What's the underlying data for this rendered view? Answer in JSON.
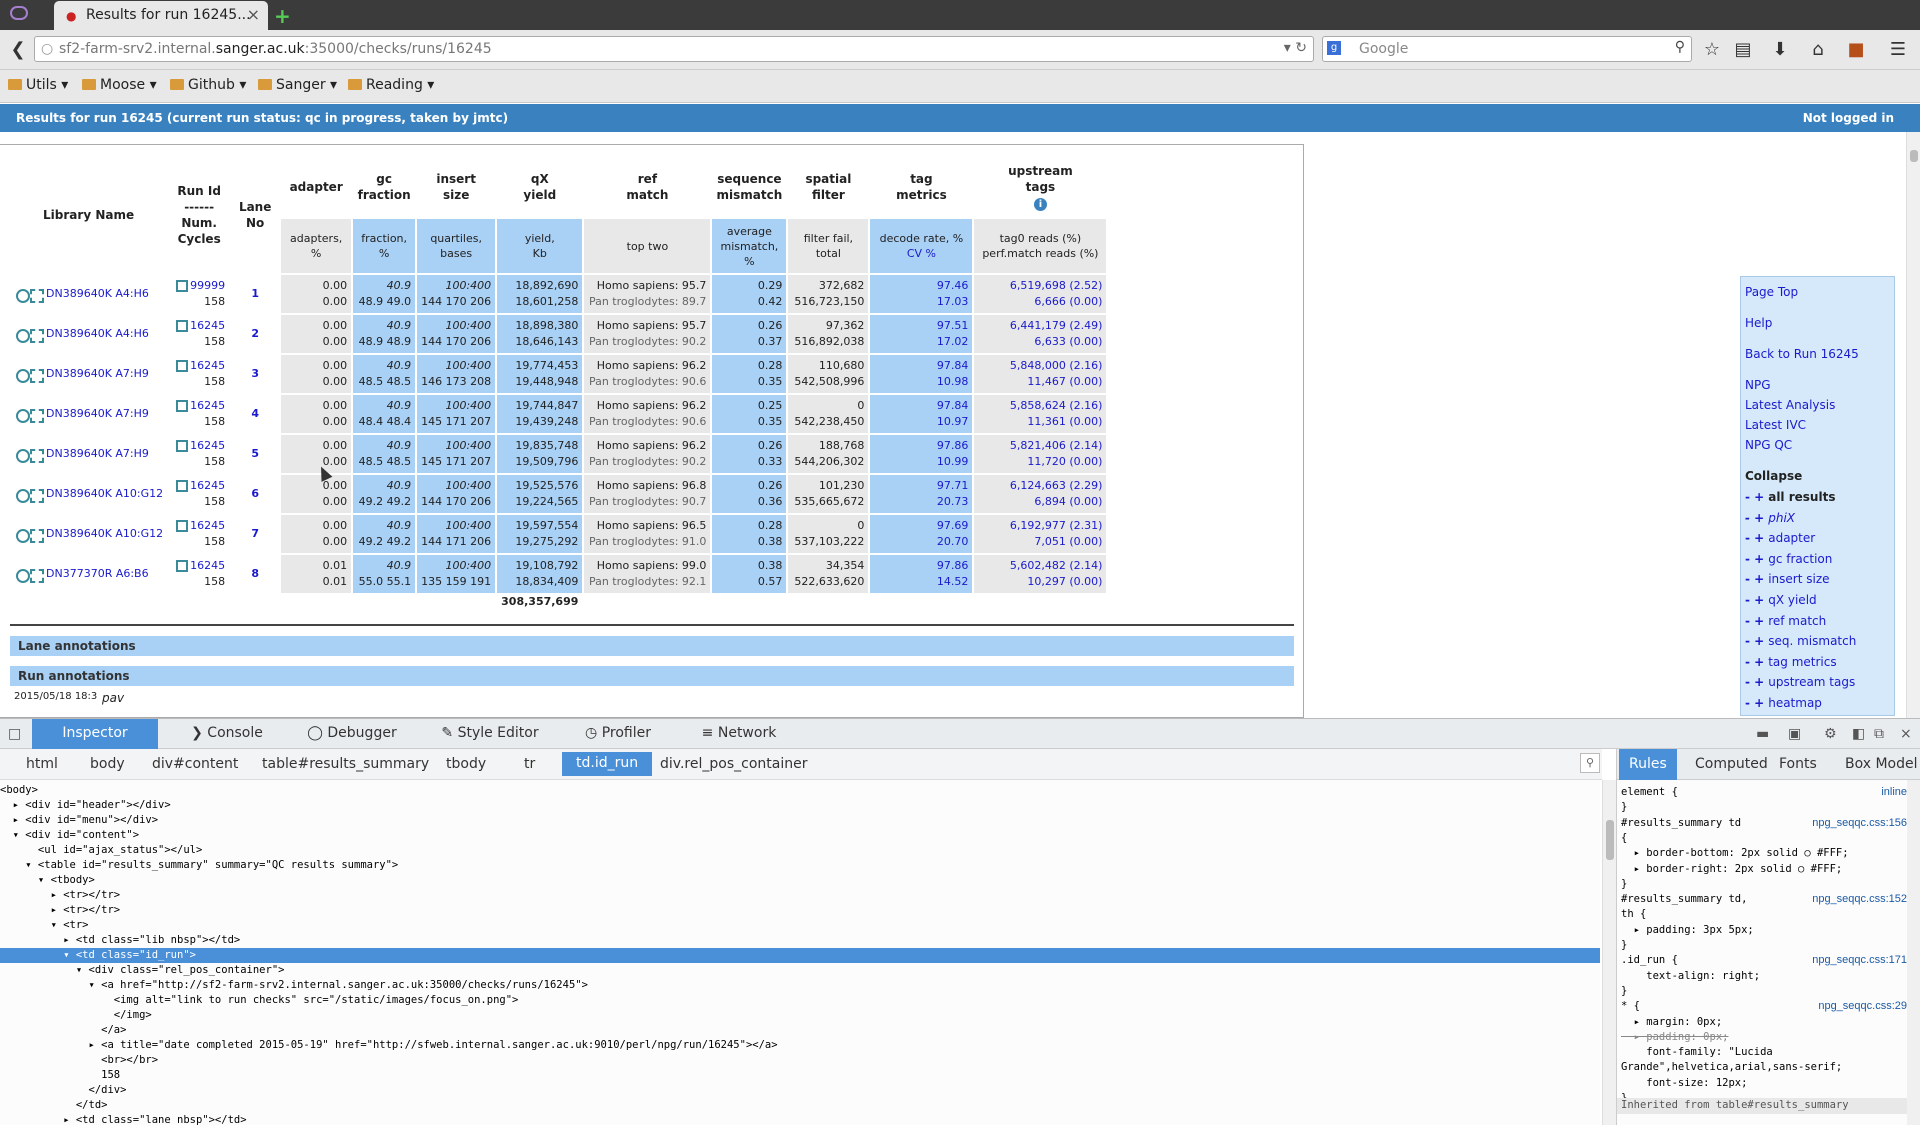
{
  "browser": {
    "tab_title": "Results for run 16245...",
    "url_prefix": "sf2-farm-srv2.internal.",
    "url_domain": "sanger.ac.uk",
    "url_suffix": ":35000/checks/runs/16245",
    "search_placeholder": "Google",
    "bookmarks": [
      "Utils",
      "Moose",
      "Github",
      "Sanger",
      "Reading"
    ]
  },
  "header": {
    "title": "Results for run 16245 (current run status: qc in progress, taken by jmtc)",
    "login_status": "Not logged in"
  },
  "table": {
    "headers": {
      "library": "Library Name",
      "run_id": "Run Id",
      "run_sep": "------",
      "num": "Num.",
      "cycles": "Cycles",
      "lane": "Lane",
      "lane_no": "No",
      "adapter": "adapter",
      "gc1": "gc",
      "gc2": "fraction",
      "insert1": "insert",
      "insert2": "size",
      "qx1": "qX",
      "qx2": "yield",
      "ref1": "ref",
      "ref2": "match",
      "seq1": "sequence",
      "seq2": "mismatch",
      "spatial1": "spatial",
      "spatial2": "filter",
      "tag1": "tag",
      "tag2": "metrics",
      "up1": "upstream",
      "up2": "tags"
    },
    "subheaders": {
      "adapter1": "adapters,",
      "adapter2": "%",
      "gc1": "fraction,",
      "gc2": "%",
      "insert1": "quartiles,",
      "insert2": "bases",
      "qx1": "yield,",
      "qx2": "Kb",
      "ref": "top two",
      "seq1": "average",
      "seq2": "mismatch,",
      "seq3": "%",
      "spatial1": "filter fail,",
      "spatial2": "total",
      "tag1": "decode rate, %",
      "tag2": "CV %",
      "up1": "tag0 reads (%)",
      "up2": "perf.match reads (%)"
    },
    "rows": [
      {
        "lib": "DN389640K A4:H6",
        "run": "99999",
        "cycles": "158",
        "lane": "1",
        "ad1": "0.00",
        "ad2": "0.00",
        "gc1": "40.9",
        "gc2": "48.9 49.0",
        "is1": "100:400",
        "is2": "144 170 206",
        "qx1": "18,892,690",
        "qx2": "18,601,258",
        "ref1": "Homo sapiens: 95.7",
        "ref2": "Pan troglodytes: 89.7",
        "sm1": "0.29",
        "sm2": "0.42",
        "sf1": "372,682",
        "sf2": "516,723,150",
        "tm1": "97.46",
        "tm2": "17.03",
        "up1": "6,519,698 (2.52)",
        "up2": "6,666 (0.00)"
      },
      {
        "lib": "DN389640K A4:H6",
        "run": "16245",
        "cycles": "158",
        "lane": "2",
        "ad1": "0.00",
        "ad2": "0.00",
        "gc1": "40.9",
        "gc2": "48.9 48.9",
        "is1": "100:400",
        "is2": "144 170 206",
        "qx1": "18,898,380",
        "qx2": "18,646,143",
        "ref1": "Homo sapiens: 95.7",
        "ref2": "Pan troglodytes: 90.2",
        "sm1": "0.26",
        "sm2": "0.37",
        "sf1": "97,362",
        "sf2": "516,892,038",
        "tm1": "97.51",
        "tm2": "17.02",
        "up1": "6,441,179 (2.49)",
        "up2": "6,633 (0.00)"
      },
      {
        "lib": "DN389640K A7:H9",
        "run": "16245",
        "cycles": "158",
        "lane": "3",
        "ad1": "0.00",
        "ad2": "0.00",
        "gc1": "40.9",
        "gc2": "48.5 48.5",
        "is1": "100:400",
        "is2": "146 173 208",
        "qx1": "19,774,453",
        "qx2": "19,448,948",
        "ref1": "Homo sapiens: 96.2",
        "ref2": "Pan troglodytes: 90.6",
        "sm1": "0.28",
        "sm2": "0.35",
        "sf1": "110,680",
        "sf2": "542,508,996",
        "tm1": "97.84",
        "tm2": "10.98",
        "up1": "5,848,000 (2.16)",
        "up2": "11,467 (0.00)"
      },
      {
        "lib": "DN389640K A7:H9",
        "run": "16245",
        "cycles": "158",
        "lane": "4",
        "ad1": "0.00",
        "ad2": "0.00",
        "gc1": "40.9",
        "gc2": "48.4 48.4",
        "is1": "100:400",
        "is2": "145 171 207",
        "qx1": "19,744,847",
        "qx2": "19,439,248",
        "ref1": "Homo sapiens: 96.2",
        "ref2": "Pan troglodytes: 90.6",
        "sm1": "0.25",
        "sm2": "0.35",
        "sf1": "0",
        "sf2": "542,238,450",
        "tm1": "97.84",
        "tm2": "10.97",
        "up1": "5,858,624 (2.16)",
        "up2": "11,361 (0.00)"
      },
      {
        "lib": "DN389640K A7:H9",
        "run": "16245",
        "cycles": "158",
        "lane": "5",
        "ad1": "0.00",
        "ad2": "0.00",
        "gc1": "40.9",
        "gc2": "48.5 48.5",
        "is1": "100:400",
        "is2": "145 171 207",
        "qx1": "19,835,748",
        "qx2": "19,509,796",
        "ref1": "Homo sapiens: 96.2",
        "ref2": "Pan troglodytes: 90.2",
        "sm1": "0.26",
        "sm2": "0.33",
        "sf1": "188,768",
        "sf2": "544,206,302",
        "tm1": "97.86",
        "tm2": "10.99",
        "up1": "5,821,406 (2.14)",
        "up2": "11,720 (0.00)"
      },
      {
        "lib": "DN389640K A10:G12",
        "run": "16245",
        "cycles": "158",
        "lane": "6",
        "ad1": "0.00",
        "ad2": "0.00",
        "gc1": "40.9",
        "gc2": "49.2 49.2",
        "is1": "100:400",
        "is2": "144 170 206",
        "qx1": "19,525,576",
        "qx2": "19,224,565",
        "ref1": "Homo sapiens: 96.8",
        "ref2": "Pan troglodytes: 90.7",
        "sm1": "0.26",
        "sm2": "0.36",
        "sf1": "101,230",
        "sf2": "535,665,672",
        "tm1": "97.71",
        "tm2": "20.73",
        "up1": "6,124,663 (2.29)",
        "up2": "6,894 (0.00)"
      },
      {
        "lib": "DN389640K A10:G12",
        "run": "16245",
        "cycles": "158",
        "lane": "7",
        "ad1": "0.00",
        "ad2": "0.00",
        "gc1": "40.9",
        "gc2": "49.2 49.2",
        "is1": "100:400",
        "is2": "144 171 206",
        "qx1": "19,597,554",
        "qx2": "19,275,292",
        "ref1": "Homo sapiens: 96.5",
        "ref2": "Pan troglodytes: 91.0",
        "sm1": "0.28",
        "sm2": "0.38",
        "sf1": "0",
        "sf2": "537,103,222",
        "tm1": "97.69",
        "tm2": "20.70",
        "up1": "6,192,977 (2.31)",
        "up2": "7,051 (0.00)"
      },
      {
        "lib": "DN377370R A6:B6",
        "run": "16245",
        "cycles": "158",
        "lane": "8",
        "ad1": "0.01",
        "ad2": "0.01",
        "gc1": "40.9",
        "gc2": "55.0 55.1",
        "is1": "100:400",
        "is2": "135 159 191",
        "qx1": "19,108,792",
        "qx2": "18,834,409",
        "ref1": "Homo sapiens: 99.0",
        "ref2": "Pan troglodytes: 92.1",
        "sm1": "0.38",
        "sm2": "0.57",
        "sf1": "34,354",
        "sf2": "522,633,620",
        "tm1": "97.86",
        "tm2": "14.52",
        "up1": "5,602,482 (2.14)",
        "up2": "10,297 (0.00)"
      }
    ],
    "total_yield": "308,357,699"
  },
  "annotations": {
    "lane_title": "Lane annotations",
    "run_title": "Run annotations",
    "run_date": "2015/05/18 18:3",
    "run_user": "pav"
  },
  "sidemenu": {
    "page_top": "Page Top",
    "help": "Help",
    "back": "Back to Run 16245",
    "npg": "NPG",
    "latest_analysis": "Latest Analysis",
    "latest_ivc": "Latest IVC",
    "npg_qc": "NPG QC",
    "collapse": "Collapse",
    "pm": "- +",
    "items": [
      "all results",
      "phiX",
      "adapter",
      "gc fraction",
      "insert size",
      "qX yield",
      "ref match",
      "seq. mismatch",
      "tag metrics",
      "upstream tags",
      "heatmap"
    ]
  },
  "devtools": {
    "tabs": [
      "Inspector",
      "Console",
      "Debugger",
      "Style Editor",
      "Profiler",
      "Network"
    ],
    "breadcrumb": [
      "html",
      "body",
      "div#content",
      "table#results_summary",
      "tbody",
      "tr",
      "td.id_run",
      "div.rel_pos_container"
    ],
    "side_tabs": [
      "Rules",
      "Computed",
      "Fonts",
      "Box Model"
    ],
    "markup_lines": [
      "<body>",
      "  ▸ <div id=\"header\"></div>",
      "  ▸ <div id=\"menu\"></div>",
      "  ▾ <div id=\"content\">",
      "      <ul id=\"ajax_status\"></ul>",
      "    ▾ <table id=\"results_summary\" summary=\"QC results summary\">",
      "      ▾ <tbody>",
      "        ▸ <tr></tr>",
      "        ▸ <tr></tr>",
      "        ▾ <tr>",
      "          ▸ <td class=\"lib nbsp\"></td>",
      "          ▾ <td class=\"id_run\">",
      "            ▾ <div class=\"rel_pos_container\">",
      "              ▾ <a href=\"http://sf2-farm-srv2.internal.sanger.ac.uk:35000/checks/runs/16245\">",
      "                  <img alt=\"link to run checks\" src=\"/static/images/focus_on.png\">",
      "                  </img>",
      "                </a>",
      "              ▸ <a title=\"date completed 2015-05-19\" href=\"http://sfweb.internal.sanger.ac.uk:9010/perl/npg/run/16245\"></a>",
      "                <br></br>",
      "                158",
      "              </div>",
      "            </td>",
      "          ▸ <td class=\"lane nbsp\"></td>"
    ],
    "rules_lines": [
      {
        "text": "element {",
        "src": "inline"
      },
      {
        "text": "}",
        "src": ""
      },
      {
        "text": "#results_summary td",
        "src": "npg_seqqc.css:156"
      },
      {
        "text": "{",
        "src": ""
      },
      {
        "text": "  ▸ border-bottom: 2px solid ○ #FFF;",
        "src": ""
      },
      {
        "text": "  ▸ border-right: 2px solid ○ #FFF;",
        "src": ""
      },
      {
        "text": "}",
        "src": ""
      },
      {
        "text": "#results_summary td,",
        "src": "npg_seqqc.css:152"
      },
      {
        "text": "th {",
        "src": ""
      },
      {
        "text": "  ▸ padding: 3px 5px;",
        "src": ""
      },
      {
        "text": "}",
        "src": ""
      },
      {
        "text": ".id_run {",
        "src": "npg_seqqc.css:171"
      },
      {
        "text": "    text-align: right;",
        "src": ""
      },
      {
        "text": "}",
        "src": ""
      },
      {
        "text": "* {",
        "src": "npg_seqqc.css:29"
      },
      {
        "text": "  ▸ margin: 0px;",
        "src": ""
      },
      {
        "text": "  ▸ padding: 0px;",
        "src": ""
      },
      {
        "text": "    font-family: \"Lucida",
        "src": ""
      },
      {
        "text": "Grande\",helvetica,arial,sans-serif;",
        "src": ""
      },
      {
        "text": "    font-size: 12px;",
        "src": ""
      },
      {
        "text": "}",
        "src": ""
      }
    ],
    "inherited": "Inherited from table#results_summary"
  }
}
